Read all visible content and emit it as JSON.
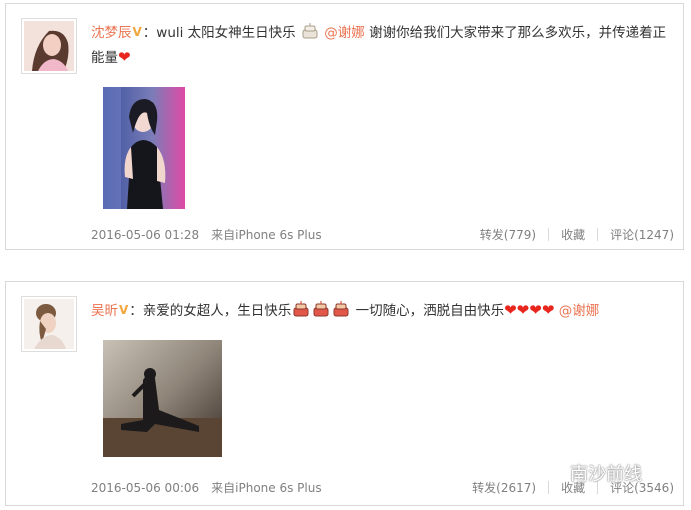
{
  "posts": [
    {
      "author": "沈梦辰",
      "colon": "：",
      "text_before": "wuli 太阳女神生日快乐",
      "mention": "@谢娜",
      "text_after": "谢谢你给我们大家带来了那么多欢乐，并传递着正能量",
      "timestamp": "2016-05-06 01:28",
      "source": "来自iPhone 6s Plus",
      "repost_label": "转发(779)",
      "favorite_label": "收藏",
      "comment_label": "评论(1247)"
    },
    {
      "author": "吴昕",
      "colon": "：",
      "text_before": "亲爱的女超人，生日快乐",
      "text_middle": "一切随心，洒脱自由快乐",
      "mention": "@谢娜",
      "timestamp": "2016-05-06 00:06",
      "source": "来自iPhone 6s Plus",
      "repost_label": "转发(2617)",
      "favorite_label": "收藏",
      "comment_label": "评论(3546)"
    }
  ],
  "watermark": {
    "text": "南沙前线"
  },
  "colors": {
    "name": "#eb7350",
    "meta": "#808080",
    "heart": "#e8261e",
    "border": "#d9d9d9"
  },
  "icons": {
    "verified": "v-icon",
    "cake": "cake-icon",
    "heart": "heart-icon",
    "wechat": "wechat-icon"
  }
}
